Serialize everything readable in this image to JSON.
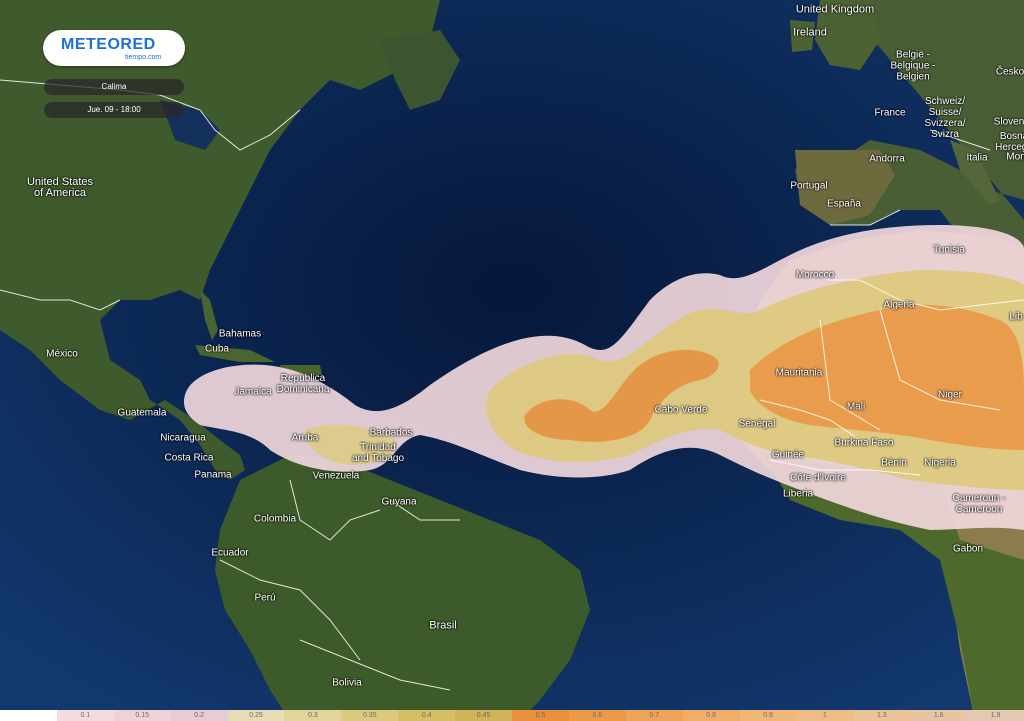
{
  "app": {
    "logo_text": "METEORED",
    "logo_sub": "tiempo.com",
    "layer_name": "Calima",
    "datetime": "Jue. 09 - 18:00"
  },
  "colors": {
    "ocean": "#0c2a5c",
    "deep_ocean": "#06173a",
    "land": "#3e5a2a",
    "desert": "#8a7a4a",
    "border": "#ffffff"
  },
  "labels": [
    {
      "text": "United Kingdom",
      "name": "label-united-kingdom"
    },
    {
      "text": "Ireland",
      "name": "label-ireland"
    },
    {
      "text": "België -\nBelgique -\nBelgien",
      "name": "label-belgium"
    },
    {
      "text": "Česko",
      "name": "label-czechia"
    },
    {
      "text": "France",
      "name": "label-france"
    },
    {
      "text": "Schweiz/\nSuisse/\nSvizzera/\nSvizra",
      "name": "label-switzerland"
    },
    {
      "text": "Slovenija",
      "name": "label-slovenia"
    },
    {
      "text": "Bosna\nHercego",
      "name": "label-bosnia"
    },
    {
      "text": "Mon",
      "name": "label-montenegro"
    },
    {
      "text": "Andorra",
      "name": "label-andorra"
    },
    {
      "text": "Italia",
      "name": "label-italy"
    },
    {
      "text": "Portugal",
      "name": "label-portugal"
    },
    {
      "text": "España",
      "name": "label-spain"
    },
    {
      "text": "Tunisia",
      "name": "label-tunisia"
    },
    {
      "text": "Morocco",
      "name": "label-morocco"
    },
    {
      "text": "Algeria",
      "name": "label-algeria"
    },
    {
      "text": "Lib",
      "name": "label-libya"
    },
    {
      "text": "Mauritania",
      "name": "label-mauritania"
    },
    {
      "text": "Mali",
      "name": "label-mali"
    },
    {
      "text": "Niger",
      "name": "label-niger"
    },
    {
      "text": "Cabo Verde",
      "name": "label-cabo-verde"
    },
    {
      "text": "Sénégal",
      "name": "label-senegal"
    },
    {
      "text": "Burkina Faso",
      "name": "label-burkina-faso"
    },
    {
      "text": "Guinée",
      "name": "label-guinee"
    },
    {
      "text": "Bénin",
      "name": "label-benin"
    },
    {
      "text": "Côte d'Ivoire",
      "name": "label-cote-divoire"
    },
    {
      "text": "Nigeria",
      "name": "label-nigeria"
    },
    {
      "text": "Liberia",
      "name": "label-liberia"
    },
    {
      "text": "Cameroun -\nCameroon",
      "name": "label-cameroon"
    },
    {
      "text": "Gabon",
      "name": "label-gabon"
    },
    {
      "text": "United States\nof America",
      "name": "label-usa"
    },
    {
      "text": "México",
      "name": "label-mexico"
    },
    {
      "text": "Bahamas",
      "name": "label-bahamas"
    },
    {
      "text": "Cuba",
      "name": "label-cuba"
    },
    {
      "text": "República\nDominicana",
      "name": "label-dominican-republic"
    },
    {
      "text": "Jamaica",
      "name": "label-jamaica"
    },
    {
      "text": "Guatemala",
      "name": "label-guatemala"
    },
    {
      "text": "Nicaragua",
      "name": "label-nicaragua"
    },
    {
      "text": "Costa Rica",
      "name": "label-costa-rica"
    },
    {
      "text": "Panama",
      "name": "label-panama"
    },
    {
      "text": "Aruba",
      "name": "label-aruba"
    },
    {
      "text": "Barbados",
      "name": "label-barbados"
    },
    {
      "text": "Trinidad\nand Tobago",
      "name": "label-trinidad-tobago"
    },
    {
      "text": "Venezuela",
      "name": "label-venezuela"
    },
    {
      "text": "Guyana",
      "name": "label-guyana"
    },
    {
      "text": "Colombia",
      "name": "label-colombia"
    },
    {
      "text": "Ecuador",
      "name": "label-ecuador"
    },
    {
      "text": "Perú",
      "name": "label-peru"
    },
    {
      "text": "Brasil",
      "name": "label-brasil"
    },
    {
      "text": "Bolivia",
      "name": "label-bolivia"
    }
  ],
  "legend": [
    {
      "value": "",
      "color": "#ffffff"
    },
    {
      "value": "0.1",
      "color": "#f3dcdc"
    },
    {
      "value": "0.15",
      "color": "#efd2d6"
    },
    {
      "value": "0.2",
      "color": "#e9cbd2"
    },
    {
      "value": "0.25",
      "color": "#e8dcb4"
    },
    {
      "value": "0.3",
      "color": "#e2d49a"
    },
    {
      "value": "0.35",
      "color": "#ddc97e"
    },
    {
      "value": "0.4",
      "color": "#d6be66"
    },
    {
      "value": "0.45",
      "color": "#d2b458"
    },
    {
      "value": "0.5",
      "color": "#e8903c"
    },
    {
      "value": "0.6",
      "color": "#eb9a48"
    },
    {
      "value": "0.7",
      "color": "#eea55a"
    },
    {
      "value": "0.8",
      "color": "#f0ae68"
    },
    {
      "value": "0.9",
      "color": "#f2b776"
    },
    {
      "value": "1",
      "color": "#f0bc86"
    },
    {
      "value": "1.3",
      "color": "#ecc298"
    },
    {
      "value": "1.6",
      "color": "#e8c4a4"
    },
    {
      "value": "1.9",
      "color": "#e4c8b0"
    }
  ]
}
